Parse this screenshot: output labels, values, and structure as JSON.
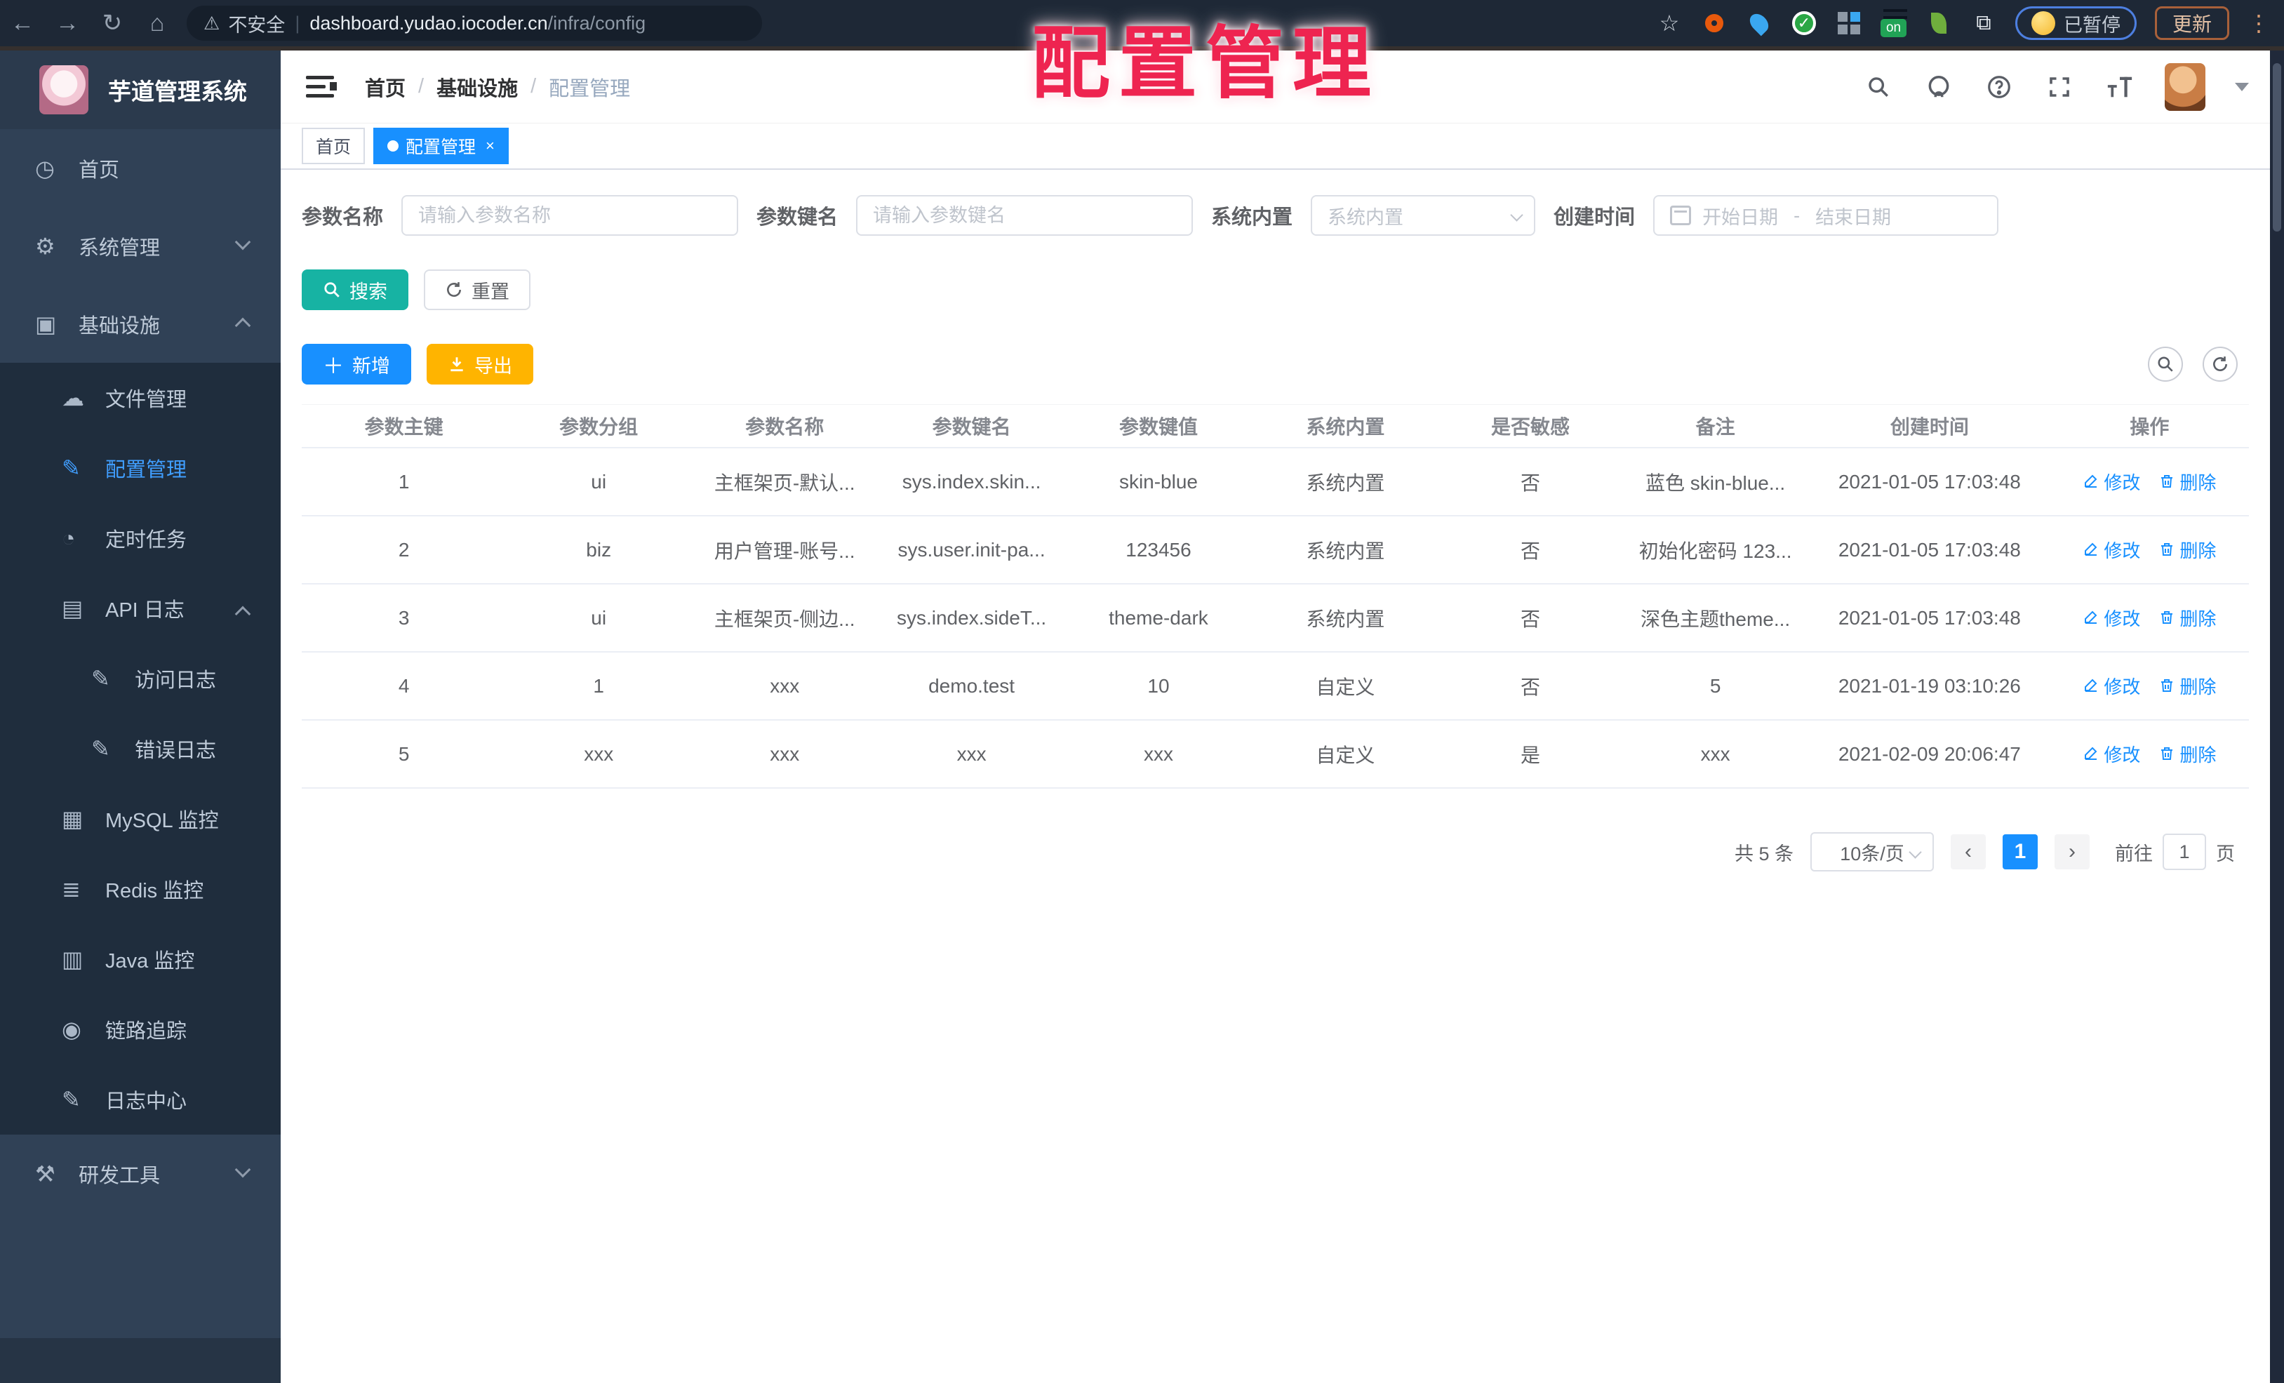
{
  "browser": {
    "security_label": "不安全",
    "url_host": "dashboard.yudao.iocoder.cn",
    "url_path": "/infra/config",
    "on_badge": "on",
    "paused_label": "已暂停",
    "update_label": "更新"
  },
  "overlay": {
    "title": "配置管理"
  },
  "sidebar": {
    "logo_title": "芋道管理系统",
    "items": [
      {
        "name": "home",
        "label": "首页",
        "glyph": "◷",
        "level": 1
      },
      {
        "name": "system",
        "label": "系统管理",
        "glyph": "⚙",
        "level": 1,
        "chevron": "down"
      },
      {
        "name": "infra",
        "label": "基础设施",
        "glyph": "▣",
        "level": 1,
        "chevron": "up"
      },
      {
        "name": "file",
        "label": "文件管理",
        "glyph": "☁",
        "level": 2,
        "dark": true
      },
      {
        "name": "config",
        "label": "配置管理",
        "glyph": "✎",
        "level": 2,
        "dark": true,
        "active": true
      },
      {
        "name": "job",
        "label": "定时任务",
        "glyph": "◔",
        "level": 2,
        "dark": true
      },
      {
        "name": "api-log",
        "label": "API 日志",
        "glyph": "▤",
        "level": 2,
        "dark": true,
        "chevron": "up"
      },
      {
        "name": "access-log",
        "label": "访问日志",
        "glyph": "✎",
        "level": 3,
        "dark": true
      },
      {
        "name": "error-log",
        "label": "错误日志",
        "glyph": "✎",
        "level": 3,
        "dark": true
      },
      {
        "name": "mysql",
        "label": "MySQL 监控",
        "glyph": "▦",
        "level": 2,
        "dark": true
      },
      {
        "name": "redis",
        "label": "Redis 监控",
        "glyph": "≣",
        "level": 2,
        "dark": true
      },
      {
        "name": "java",
        "label": "Java 监控",
        "glyph": "▥",
        "level": 2,
        "dark": true
      },
      {
        "name": "trace",
        "label": "链路追踪",
        "glyph": "◉",
        "level": 2,
        "dark": true
      },
      {
        "name": "log-center",
        "label": "日志中心",
        "glyph": "✎",
        "level": 2,
        "dark": true
      },
      {
        "name": "devtools",
        "label": "研发工具",
        "glyph": "⚒",
        "level": 1,
        "chevron": "down"
      }
    ]
  },
  "header": {
    "breadcrumb": [
      {
        "label": "首页",
        "current": false
      },
      {
        "label": "基础设施",
        "current": false
      },
      {
        "label": "配置管理",
        "current": true
      }
    ]
  },
  "tags": [
    {
      "label": "首页",
      "active": false,
      "closable": false
    },
    {
      "label": "配置管理",
      "active": true,
      "closable": true
    }
  ],
  "filters": {
    "name_label": "参数名称",
    "name_placeholder": "请输入参数名称",
    "key_label": "参数键名",
    "key_placeholder": "请输入参数键名",
    "type_label": "系统内置",
    "type_placeholder": "系统内置",
    "time_label": "创建时间",
    "start_placeholder": "开始日期",
    "range_separator": "-",
    "end_placeholder": "结束日期"
  },
  "toolbar": {
    "search_label": "搜索",
    "reset_label": "重置",
    "add_label": "新增",
    "export_label": "导出"
  },
  "table": {
    "columns": [
      "参数主键",
      "参数分组",
      "参数名称",
      "参数键名",
      "参数键值",
      "系统内置",
      "是否敏感",
      "备注",
      "创建时间",
      "操作"
    ],
    "edit_label": "修改",
    "delete_label": "删除",
    "rows": [
      {
        "id": "1",
        "group": "ui",
        "name": "主框架页-默认...",
        "key": "sys.index.skin...",
        "value": "skin-blue",
        "builtin": "系统内置",
        "sensitive": "否",
        "remark": "蓝色 skin-blue...",
        "created": "2021-01-05 17:03:48"
      },
      {
        "id": "2",
        "group": "biz",
        "name": "用户管理-账号...",
        "key": "sys.user.init-pa...",
        "value": "123456",
        "builtin": "系统内置",
        "sensitive": "否",
        "remark": "初始化密码 123...",
        "created": "2021-01-05 17:03:48"
      },
      {
        "id": "3",
        "group": "ui",
        "name": "主框架页-侧边...",
        "key": "sys.index.sideT...",
        "value": "theme-dark",
        "builtin": "系统内置",
        "sensitive": "否",
        "remark": "深色主题theme...",
        "created": "2021-01-05 17:03:48"
      },
      {
        "id": "4",
        "group": "1",
        "name": "xxx",
        "key": "demo.test",
        "value": "10",
        "builtin": "自定义",
        "sensitive": "否",
        "remark": "5",
        "created": "2021-01-19 03:10:26"
      },
      {
        "id": "5",
        "group": "xxx",
        "name": "xxx",
        "key": "xxx",
        "value": "xxx",
        "builtin": "自定义",
        "sensitive": "是",
        "remark": "xxx",
        "created": "2021-02-09 20:06:47"
      }
    ]
  },
  "pagination": {
    "total_label": "共 5 条",
    "page_size_label": "10条/页",
    "prev_glyph": "‹",
    "current_page": "1",
    "next_glyph": "›",
    "goto_label": "前往",
    "goto_value": "1",
    "unit_label": "页"
  },
  "colors": {
    "accent_blue": "#1890ff",
    "teal": "#17b3a3",
    "amber": "#ffb400",
    "annotation_red": "#ee2450",
    "sidebar_bg": "#304156",
    "submenu_bg": "#1f2d3d"
  }
}
